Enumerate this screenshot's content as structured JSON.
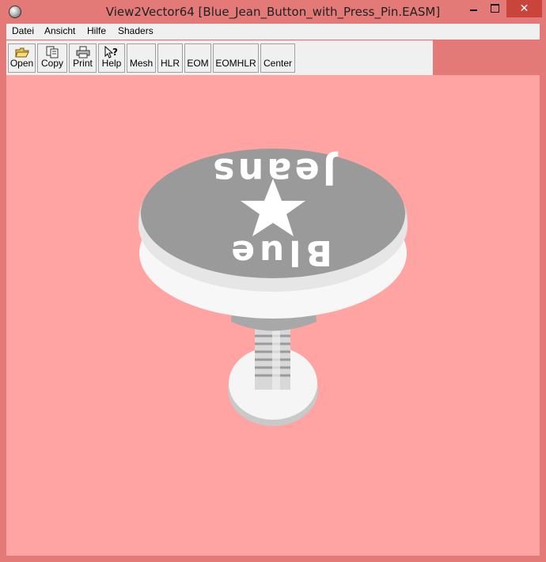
{
  "window": {
    "title": "View2Vector64 [Blue_Jean_Button_with_Press_Pin.EASM]",
    "close_label": "✕",
    "min_icon": "minimize-icon",
    "max_icon": "maximize-icon",
    "accent": "#e37a78",
    "viewport_color": "#ffa3a3"
  },
  "menu": [
    "Datei",
    "Ansicht",
    "Hilfe",
    "Shaders"
  ],
  "toolbar": {
    "open": "Open",
    "copy": "Copy",
    "print": "Print",
    "help": "Help",
    "mesh": "Mesh",
    "hlr": "HLR",
    "eom": "EOM",
    "eomhlr": "EOMHLR",
    "center": "Center"
  },
  "model": {
    "text_top": "Jeans",
    "text_bottom": "Blue"
  }
}
